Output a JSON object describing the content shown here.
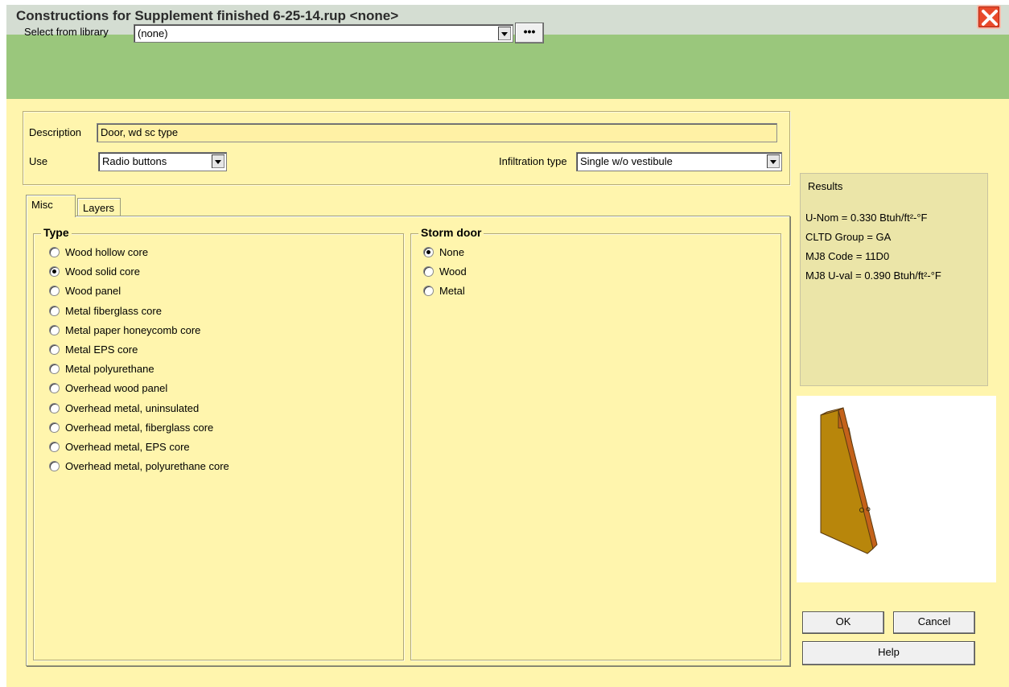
{
  "window": {
    "title": "Constructions for Supplement finished 6-25-14.rup <none>"
  },
  "library": {
    "label": "Select from library",
    "value": "(none)",
    "more_label": "•••"
  },
  "description": {
    "label": "Description",
    "value": "Door, wd sc type"
  },
  "use": {
    "label": "Use",
    "value": "Radio buttons"
  },
  "infiltration": {
    "label": "Infiltration type",
    "value": "Single w/o vestibule"
  },
  "tabs": [
    {
      "label": "Misc",
      "active": true
    },
    {
      "label": "Layers",
      "active": false
    }
  ],
  "type_group": {
    "title": "Type",
    "options": [
      {
        "label": "Wood hollow core",
        "checked": false
      },
      {
        "label": "Wood solid core",
        "checked": true
      },
      {
        "label": "Wood panel",
        "checked": false
      },
      {
        "label": "Metal fiberglass core",
        "checked": false
      },
      {
        "label": "Metal paper honeycomb core",
        "checked": false
      },
      {
        "label": "Metal EPS core",
        "checked": false
      },
      {
        "label": "Metal polyurethane",
        "checked": false
      },
      {
        "label": "Overhead wood panel",
        "checked": false
      },
      {
        "label": "Overhead metal, uninsulated",
        "checked": false
      },
      {
        "label": "Overhead metal, fiberglass core",
        "checked": false
      },
      {
        "label": "Overhead metal, EPS core",
        "checked": false
      },
      {
        "label": "Overhead metal, polyurethane core",
        "checked": false
      }
    ]
  },
  "storm_group": {
    "title": "Storm door",
    "options": [
      {
        "label": "None",
        "checked": true
      },
      {
        "label": "Wood",
        "checked": false
      },
      {
        "label": "Metal",
        "checked": false
      }
    ]
  },
  "results": {
    "title": "Results",
    "lines": [
      "U-Nom = 0.330 Btuh/ft²-°F",
      "CLTD Group = GA",
      "MJ8 Code = 11D0",
      "MJ8 U-val = 0.390 Btuh/ft²-°F"
    ]
  },
  "buttons": {
    "ok": "OK",
    "cancel": "Cancel",
    "help": "Help"
  },
  "colors": {
    "title_bar": "#d4ddd2",
    "library_band": "#9ac77c",
    "main_bg": "#fff5ad",
    "results_bg": "#ebe5a8",
    "close_button": "#e84a2b",
    "door_face": "#b8860b",
    "door_edge": "#c4621a"
  },
  "icons": {
    "close": "close-x-icon",
    "preview": "door-preview-icon"
  }
}
